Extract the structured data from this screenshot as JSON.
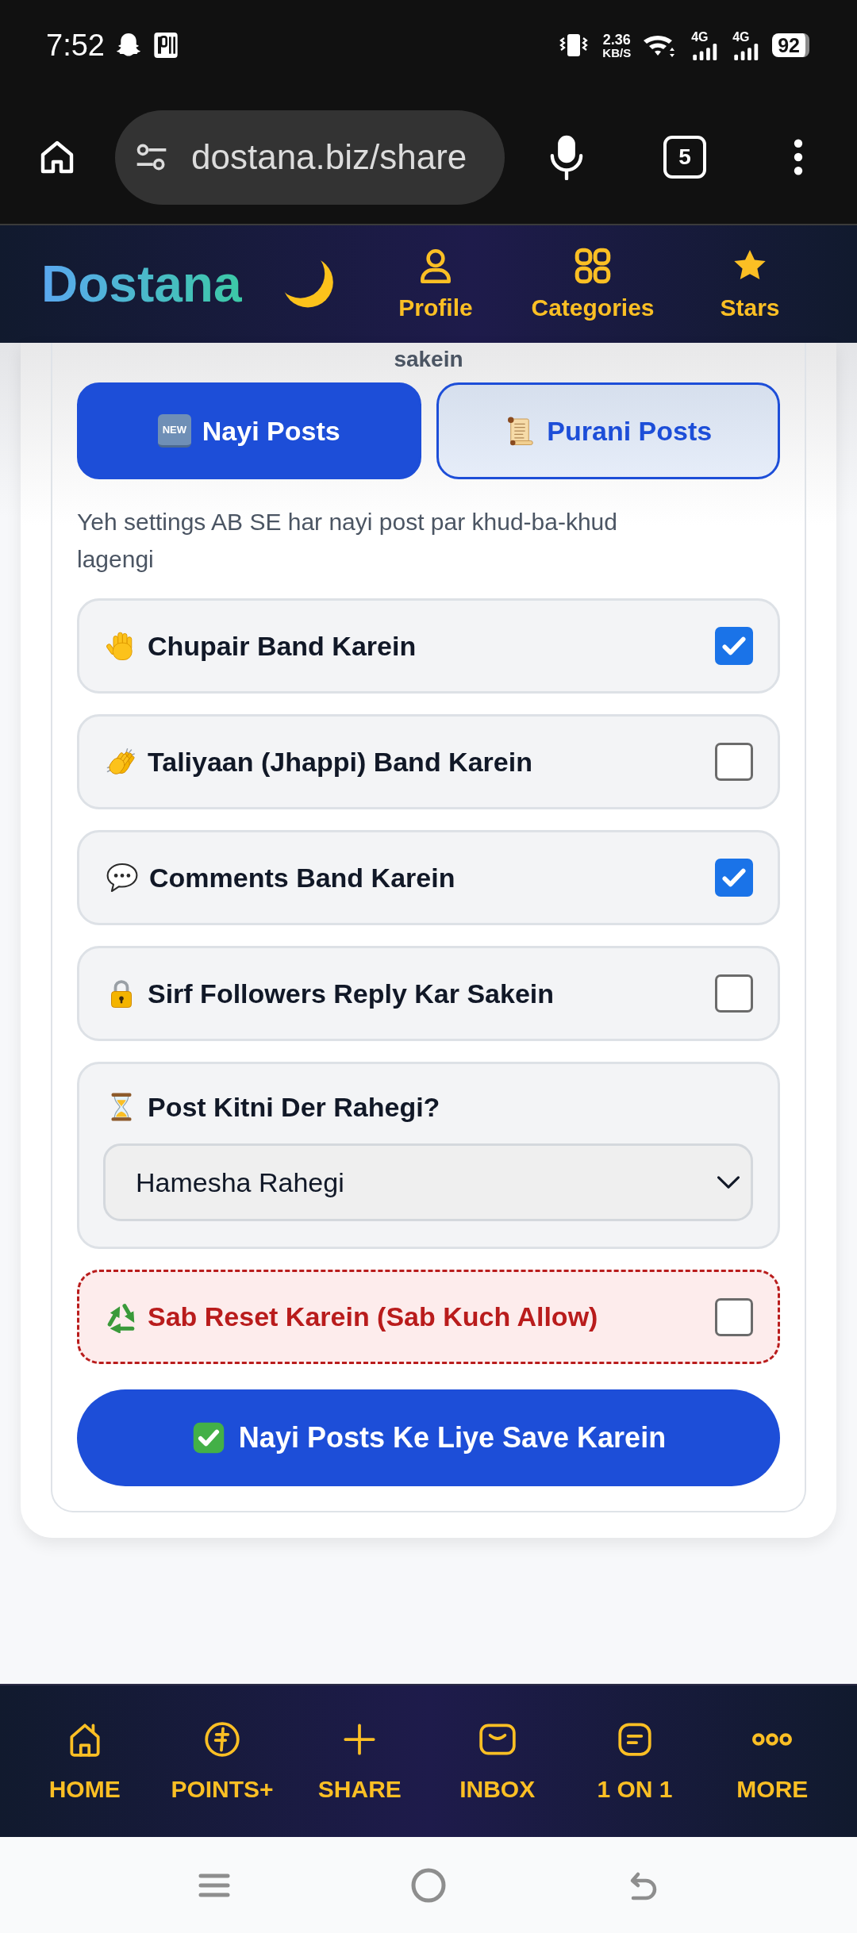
{
  "status_bar": {
    "time": "7:52",
    "speed_value": "2.36",
    "speed_unit": "KB/S",
    "networks": [
      "4G",
      "4G"
    ],
    "battery": "92"
  },
  "browser": {
    "url": "dostana.biz/share",
    "tab_count": "5"
  },
  "header": {
    "logo": "Dostana",
    "nav": [
      {
        "label": "Profile"
      },
      {
        "label": "Categories"
      },
      {
        "label": "Stars"
      }
    ]
  },
  "card": {
    "cut_text": "sakein",
    "tabs": [
      {
        "label": "Nayi Posts",
        "selected": true,
        "badge": "NEW"
      },
      {
        "label": "Purani Posts",
        "selected": false
      }
    ],
    "note": "Yeh settings AB SE har nayi post par khud-ba-khud lagengi",
    "settings": [
      {
        "label": "Chupair Band Karein",
        "checked": true
      },
      {
        "label": "Taliyaan (Jhappi) Band Karein",
        "checked": false
      },
      {
        "label": "Comments Band Karein",
        "checked": true
      },
      {
        "label": "Sirf Followers Reply Kar Sakein",
        "checked": false
      }
    ],
    "duration": {
      "label": "Post Kitni Der Rahegi?",
      "value": "Hamesha Rahegi"
    },
    "reset": {
      "label": "Sab Reset Karein (Sab Kuch Allow)",
      "checked": false
    },
    "save_button": "Nayi Posts Ke Liye Save Karein"
  },
  "bottom_nav": [
    {
      "label": "HOME"
    },
    {
      "label": "POINTS+"
    },
    {
      "label": "SHARE"
    },
    {
      "label": "INBOX"
    },
    {
      "label": "1 ON 1"
    },
    {
      "label": "MORE"
    }
  ]
}
